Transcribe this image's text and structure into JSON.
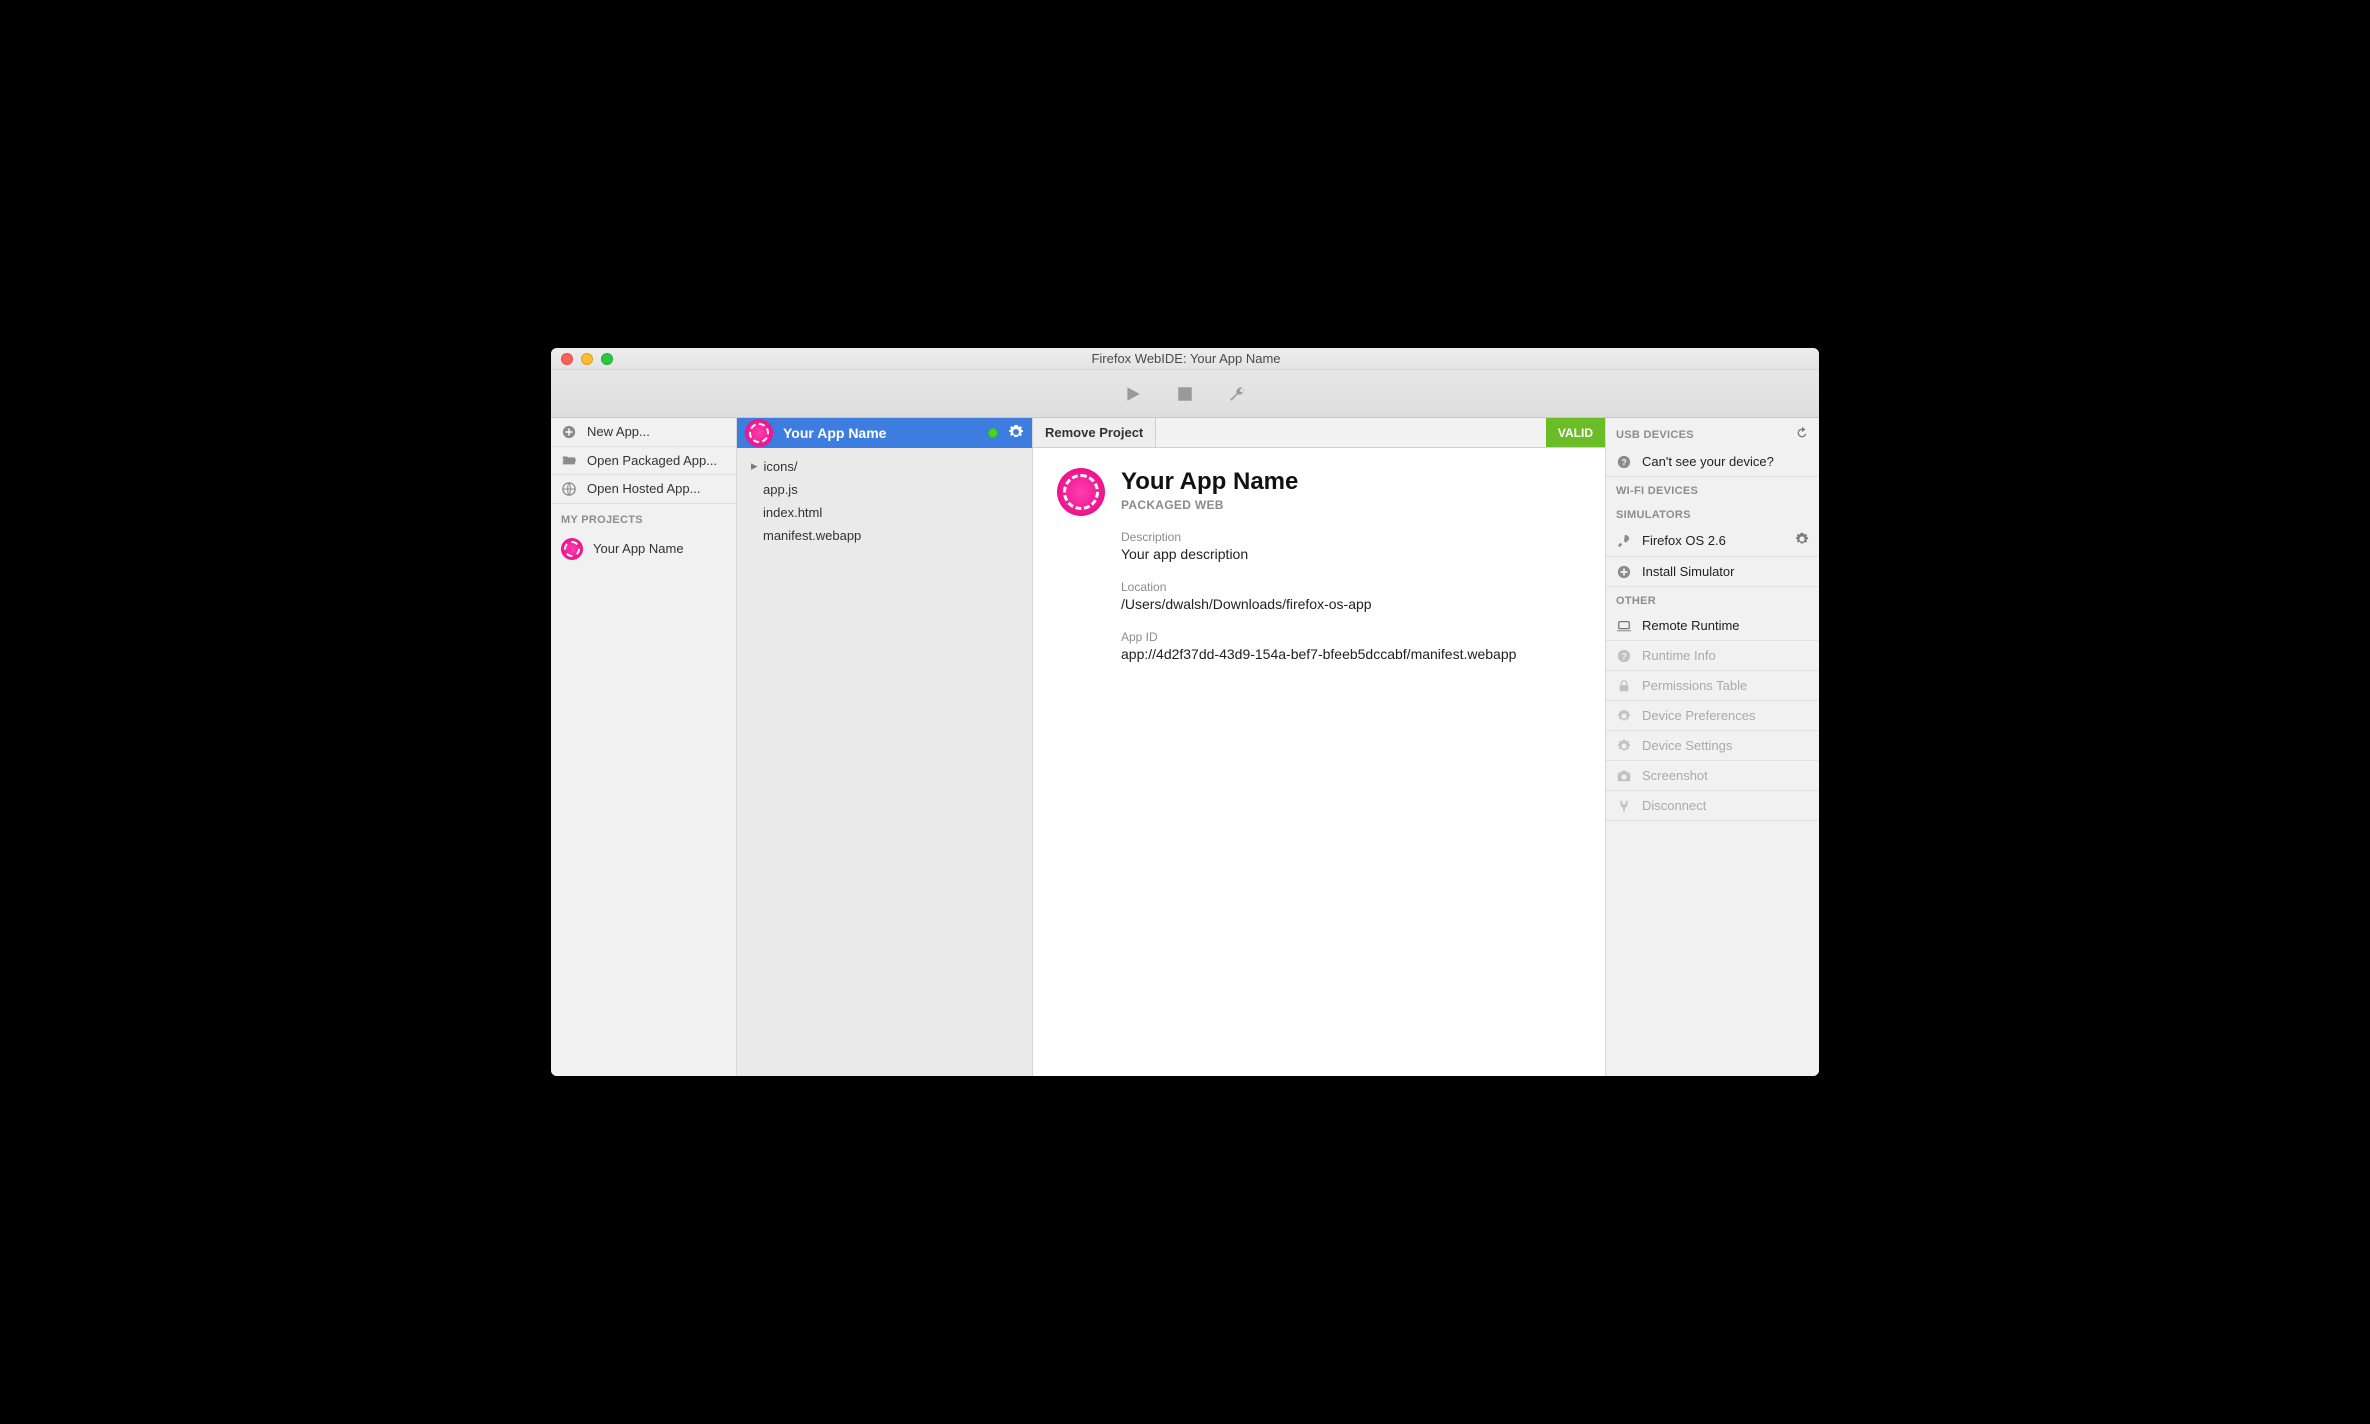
{
  "window": {
    "title": "Firefox WebIDE: Your App Name"
  },
  "toolbar": {
    "play": "Play",
    "stop": "Stop",
    "tools": "Tools"
  },
  "leftPanel": {
    "newApp": "New App...",
    "openPackaged": "Open Packaged App...",
    "openHosted": "Open Hosted App...",
    "myProjects": "MY PROJECTS",
    "project": "Your App Name"
  },
  "tree": {
    "headerName": "Your App Name",
    "items": [
      {
        "label": "icons/",
        "folder": true
      },
      {
        "label": "app.js",
        "folder": false
      },
      {
        "label": "index.html",
        "folder": false
      },
      {
        "label": "manifest.webapp",
        "folder": false
      }
    ]
  },
  "projectHeader": {
    "remove": "Remove Project",
    "valid": "VALID"
  },
  "app": {
    "name": "Your App Name",
    "type": "PACKAGED WEB",
    "descriptionLabel": "Description",
    "description": "Your app description",
    "locationLabel": "Location",
    "location": "/Users/dwalsh/Downloads/firefox-os-app",
    "appIdLabel": "App ID",
    "appId": "app://4d2f37dd-43d9-154a-bef7-bfeeb5dccabf/manifest.webapp"
  },
  "right": {
    "usb": "USB DEVICES",
    "cantSee": "Can't see your device?",
    "wifi": "WI-FI DEVICES",
    "simulators": "SIMULATORS",
    "simName": "Firefox OS 2.6",
    "installSim": "Install Simulator",
    "other": "OTHER",
    "remoteRuntime": "Remote Runtime",
    "runtimeInfo": "Runtime Info",
    "permissions": "Permissions Table",
    "devicePrefs": "Device Preferences",
    "deviceSettings": "Device Settings",
    "screenshot": "Screenshot",
    "disconnect": "Disconnect"
  }
}
